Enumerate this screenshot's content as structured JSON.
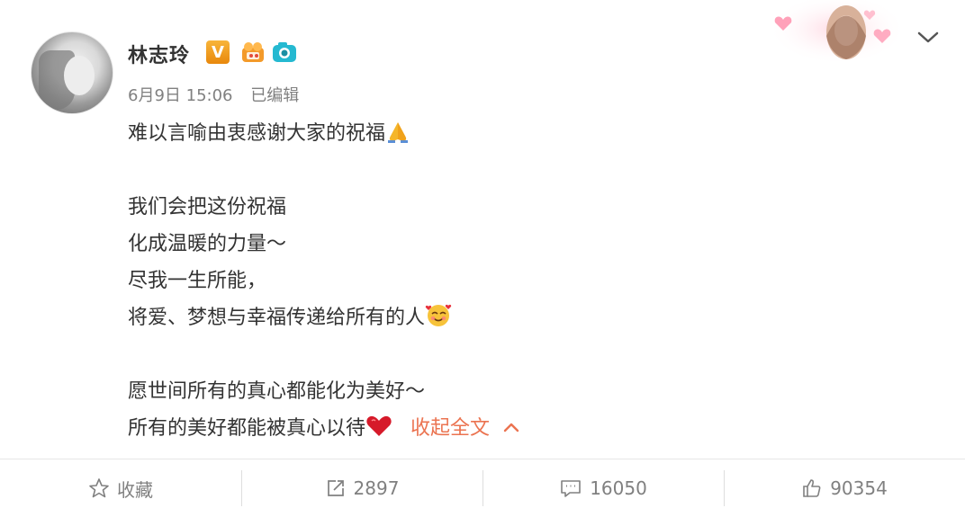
{
  "user": {
    "name": "林志玲",
    "verified_badge": "V",
    "timestamp": "6月9日 15:06",
    "edited": "已编辑"
  },
  "post": {
    "lines": [
      "难以言喻由衷感谢大家的祝福",
      "",
      "我们会把这份祝福",
      "化成温暖的力量～",
      "尽我一生所能，",
      "将爱、梦想与幸福传递给所有的人",
      "",
      "愿世间所有的真心都能化为美好～",
      "所有的美好都能被真心以待"
    ],
    "collapse_label": "收起全文"
  },
  "actions": {
    "favorite": "收藏",
    "repost": "2897",
    "comment": "16050",
    "like": "90354"
  },
  "colors": {
    "accent": "#eb7350",
    "muted": "#808080",
    "text": "#333333"
  },
  "icons": [
    "avatar",
    "verified-v-icon",
    "member-hand-icon",
    "camera-icon",
    "card-sticker",
    "chevron-down-icon",
    "pray-emoji",
    "smile-hearts-emoji",
    "heart-emoji",
    "chevron-up-icon",
    "star-icon",
    "repost-icon",
    "comment-icon",
    "thumbs-up-icon"
  ]
}
